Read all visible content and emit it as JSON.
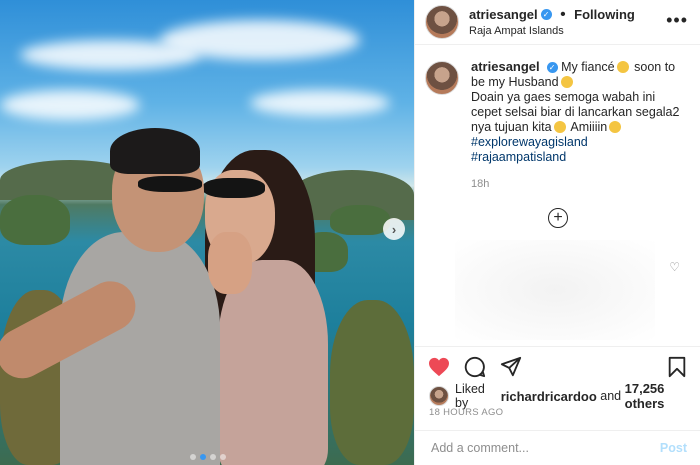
{
  "header": {
    "username": "atriesangel",
    "separator": "•",
    "follow_status": "Following",
    "location": "Raja Ampat Islands",
    "more_icon": "more-horizontal-icon"
  },
  "caption": {
    "username": "atriesangel",
    "line1": "My fiancé",
    "line1b": "soon to be my Husband",
    "line2": "Doain ya gaes semoga wabah ini cepet selsai biar di lancarkan segala2 nya tujuan kita",
    "line2b": "Amiiiin",
    "hashtags": [
      "#explorewayagisland",
      "#rajaampatisland"
    ],
    "time": "18h"
  },
  "media": {
    "next_label": "›",
    "dots_count": 4,
    "active_dot": 1
  },
  "actions": {
    "like": "heart-icon",
    "comment": "comment-icon",
    "share": "share-icon",
    "save": "bookmark-icon",
    "like_color": "#ed4956"
  },
  "likes": {
    "prefix": "Liked by",
    "user": "richardricardoo",
    "middle": "and",
    "count": "17,256 others"
  },
  "timestamp": "18 HOURS AGO",
  "comment_box": {
    "placeholder": "Add a comment...",
    "post_label": "Post"
  }
}
